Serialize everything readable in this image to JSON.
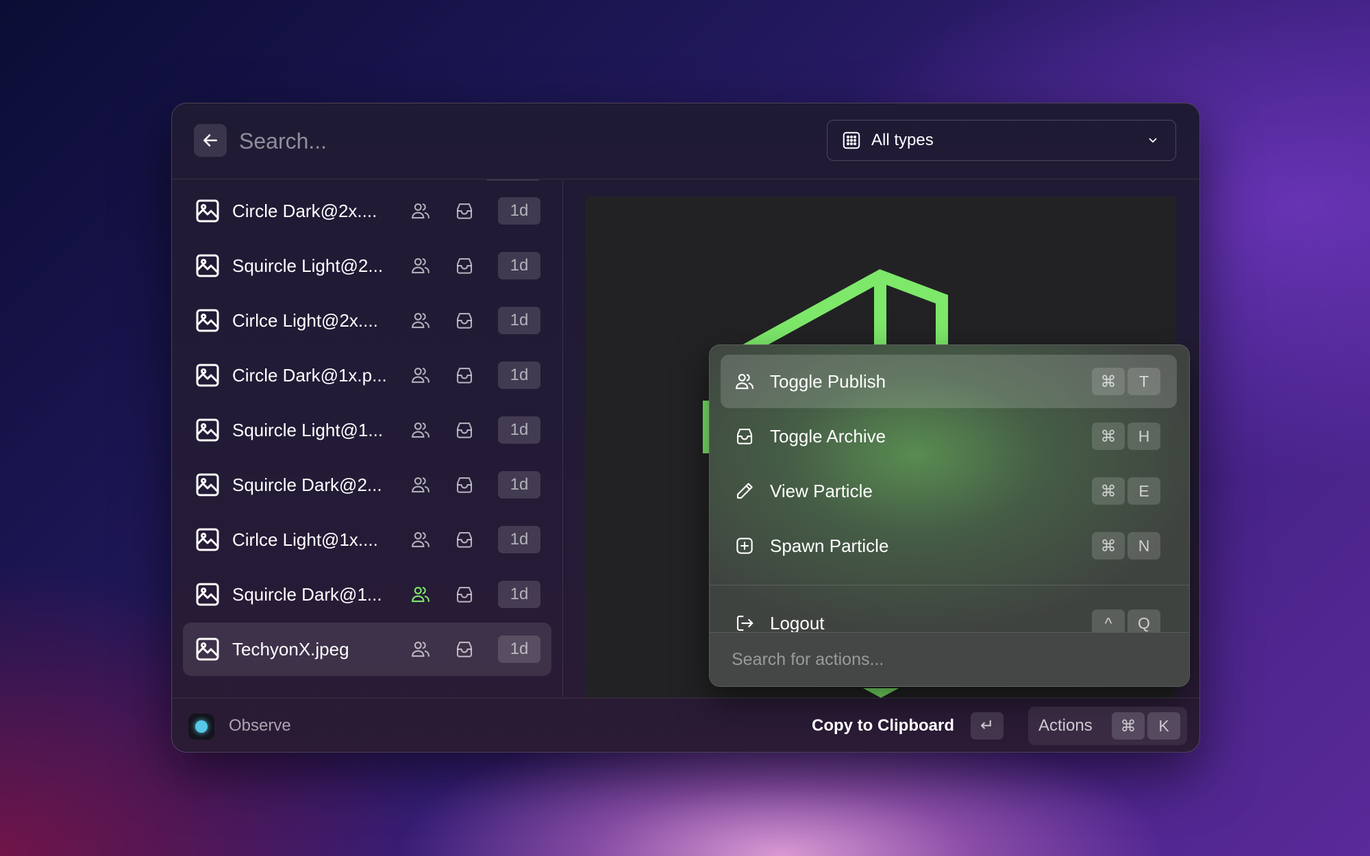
{
  "search": {
    "placeholder": "Search..."
  },
  "type_filter": {
    "label": "All types"
  },
  "items": [
    {
      "name": "Circle Dark@2x....",
      "age": "1d",
      "published": false,
      "selected": false
    },
    {
      "name": "Squircle Light@2...",
      "age": "1d",
      "published": false,
      "selected": false
    },
    {
      "name": "Cirlce Light@2x....",
      "age": "1d",
      "published": false,
      "selected": false
    },
    {
      "name": "Circle Dark@1x.p...",
      "age": "1d",
      "published": false,
      "selected": false
    },
    {
      "name": "Squircle Light@1...",
      "age": "1d",
      "published": false,
      "selected": false
    },
    {
      "name": "Squircle Dark@2...",
      "age": "1d",
      "published": false,
      "selected": false
    },
    {
      "name": "Cirlce Light@1x....",
      "age": "1d",
      "published": false,
      "selected": false
    },
    {
      "name": "Squircle Dark@1...",
      "age": "1d",
      "published": true,
      "selected": false
    },
    {
      "name": "TechyonX.jpeg",
      "age": "1d",
      "published": false,
      "selected": true
    }
  ],
  "actions": [
    {
      "label": "Toggle Publish",
      "icon": "users-icon",
      "keys": [
        "⌘",
        "T"
      ],
      "active": true
    },
    {
      "label": "Toggle Archive",
      "icon": "inbox-icon",
      "keys": [
        "⌘",
        "H"
      ],
      "active": false
    },
    {
      "label": "View Particle",
      "icon": "pencil-icon",
      "keys": [
        "⌘",
        "E"
      ],
      "active": false
    },
    {
      "label": "Spawn Particle",
      "icon": "plus-square-icon",
      "keys": [
        "⌘",
        "N"
      ],
      "active": false
    },
    {
      "label": "Logout",
      "icon": "logout-icon",
      "keys": [
        "^",
        "Q"
      ],
      "active": false
    }
  ],
  "action_search": {
    "placeholder": "Search for actions..."
  },
  "footer": {
    "observe_label": "Observe",
    "copy_label": "Copy to Clipboard",
    "enter_key": "↵",
    "actions_label": "Actions",
    "actions_keys": [
      "⌘",
      "K"
    ]
  },
  "colors": {
    "accent_green": "#7de86a",
    "observe_dot": "#56c8e8"
  }
}
